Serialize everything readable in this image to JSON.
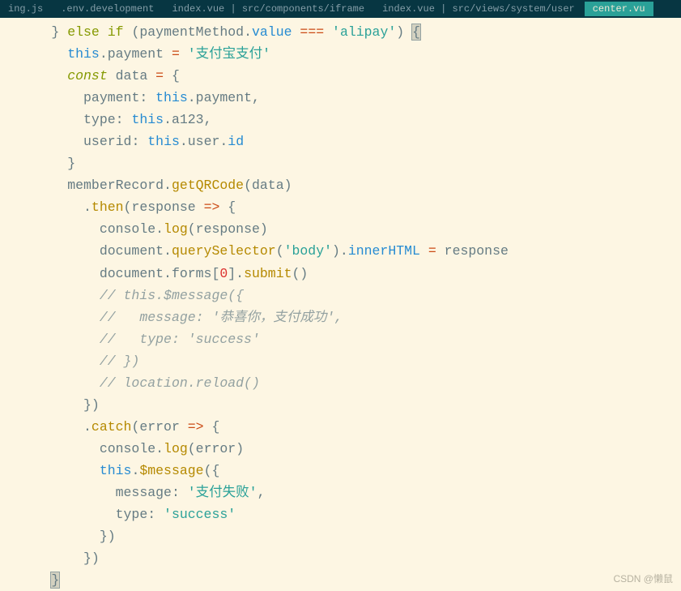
{
  "tabs": [
    {
      "label": "ing.js"
    },
    {
      "label": ".env.development"
    },
    {
      "label": "index.vue | src/components/iframe"
    },
    {
      "label": "index.vue | src/views/system/user"
    },
    {
      "label": "center.vu",
      "active": true
    }
  ],
  "watermark": "CSDN @懒鼠",
  "code": {
    "l1": {
      "else": "else",
      "if": "if",
      "var": "paymentMethod",
      "value": "value",
      "eq": "===",
      "lit": "'alipay'"
    },
    "l2": {
      "this": "this",
      "payment": "payment",
      "eq": "=",
      "str": "'支付宝支付'"
    },
    "l3": {
      "const": "const",
      "data": "data",
      "eq": "="
    },
    "l4": {
      "key": "payment",
      "this": "this",
      "val": "payment"
    },
    "l5": {
      "key": "type",
      "this": "this",
      "val": "a123"
    },
    "l6": {
      "key": "userid",
      "this": "this",
      "user": "user",
      "id": "id"
    },
    "l8": {
      "obj": "memberRecord",
      "fn": "getQRCode",
      "arg": "data"
    },
    "l9": {
      "fn": "then",
      "arg": "response"
    },
    "l10": {
      "obj": "console",
      "fn": "log",
      "arg": "response"
    },
    "l11": {
      "doc": "document",
      "fn": "querySelector",
      "sel": "'body'",
      "inner": "innerHTML",
      "eq": "=",
      "resp": "response"
    },
    "l12": {
      "doc": "document",
      "forms": "forms",
      "idx": "0",
      "fn": "submit"
    },
    "l13": {
      "c": "// this.$message({"
    },
    "l14": {
      "c": "//   message: '恭喜你，支付成功',"
    },
    "l15": {
      "c": "//   type: 'success'"
    },
    "l16": {
      "c": "// })"
    },
    "l17": {
      "c": "// location.reload()"
    },
    "l19": {
      "fn": "catch",
      "arg": "error"
    },
    "l20": {
      "obj": "console",
      "fn": "log",
      "arg": "error"
    },
    "l21": {
      "this": "this",
      "fn": "$message"
    },
    "l22": {
      "key": "message",
      "str": "'支付失败'"
    },
    "l23": {
      "key": "type",
      "str": "'success'"
    }
  }
}
